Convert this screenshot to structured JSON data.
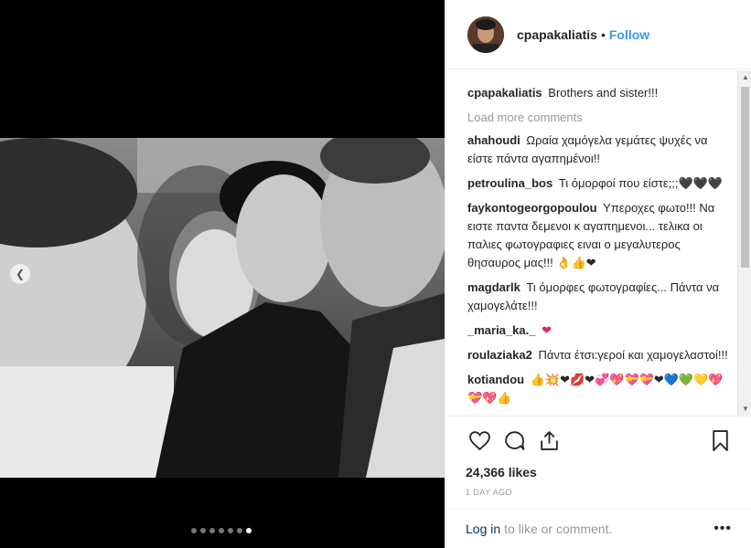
{
  "post": {
    "username": "cpapakaliatis",
    "follow_label": "Follow",
    "separator": "•",
    "caption": {
      "user": "cpapakaliatis",
      "text": "Brothers and sister!!!"
    },
    "load_more": "Load more comments",
    "comments": [
      {
        "user": "ahahoudi",
        "text": "Ωραία χαμόγελα γεμάτες ψυχές να είστε πάντα αγαπημένοι!!"
      },
      {
        "user": "petroulina_bos",
        "text": "Τι όμορφοί που είστε;;;🖤🖤🖤"
      },
      {
        "user": "faykontogeorgopoulou",
        "text": "Υπεροχες φωτο!!! Να ειστε παντα δεμενοι κ αγαπημενοι... τελικα οι παλιες φωτογραφιες ειναι ο μεγαλυτερος θησαυρος μας!!! 👌👍❤"
      },
      {
        "user": "magdarlk",
        "text": "Τι όμορφες φωτογραφίες... Πάντα να χαμογελάτε!!!"
      },
      {
        "user": "_maria_ka._",
        "text": "❤"
      },
      {
        "user": "roulaziaka2",
        "text": "Πάντα έτσι:γεροί και χαμογελαστοί!!!"
      },
      {
        "user": "kotiandou",
        "text": "👍💥❤💋❤💞💖💝💝❤💙💚💛💖💝💖👍"
      }
    ],
    "likes": "24,366 likes",
    "time": "1 DAY AGO",
    "login_link": "Log in",
    "login_text": "to like or comment.",
    "options": "•••",
    "carousel": {
      "count": 7,
      "active_index": 6
    }
  }
}
